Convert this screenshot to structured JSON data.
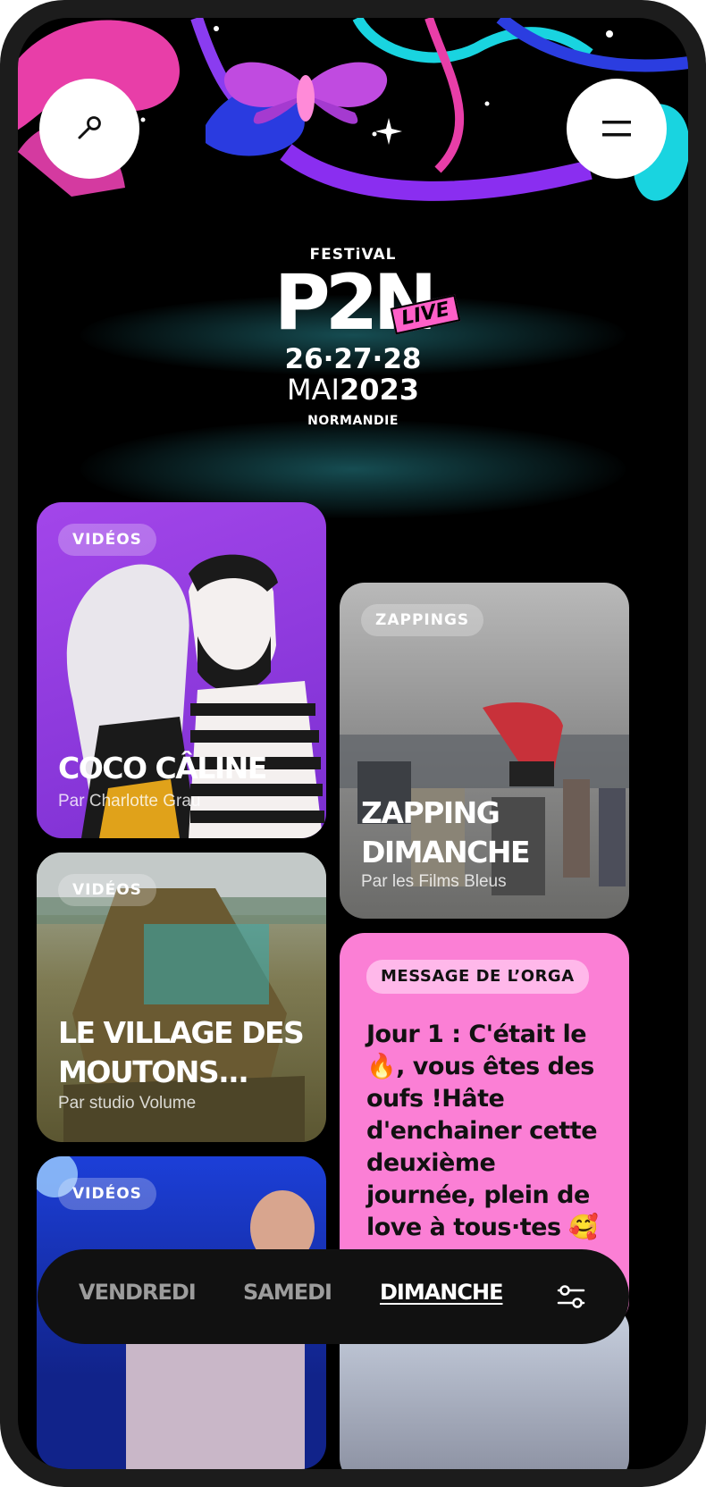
{
  "header": {
    "mic_icon": "microphone-icon",
    "menu_icon": "menu-icon"
  },
  "logo": {
    "festival": "FESTiVAL",
    "name": "P2N",
    "live": "LIVE",
    "dates": "26·27·28",
    "month": "MAI",
    "year": "2023",
    "region": "NORMANDIE"
  },
  "cards": [
    {
      "category": "VIDÉOS",
      "title": "COCO CÂLINE",
      "author": "Par Charlotte Grau"
    },
    {
      "category": "ZAPPINGS",
      "title": "ZAPPING DIMANCHE",
      "author": "Par les Films Bleus"
    },
    {
      "category": "VIDÉOS",
      "title": "LE VILLAGE DES MOUTONS...",
      "author": "Par studio Volume"
    },
    {
      "category": "MESSAGE DE L’ORGA",
      "message": "Jour 1 : C'était le 🔥, vous êtes des oufs !Hâte d'enchainer cette deuxième journée, plein de love à tous·tes 🥰"
    },
    {
      "category": "VIDÉOS"
    }
  ],
  "nav": {
    "items": [
      "VENDREDI",
      "SAMEDI",
      "DIMANCHE"
    ],
    "active": "DIMANCHE",
    "filter_icon": "filter-sliders-icon"
  },
  "colors": {
    "background": "#000000",
    "accent_pink": "#fb7fd5",
    "accent_purple": "#a346ea",
    "accent_cyan": "#19d4e0"
  }
}
